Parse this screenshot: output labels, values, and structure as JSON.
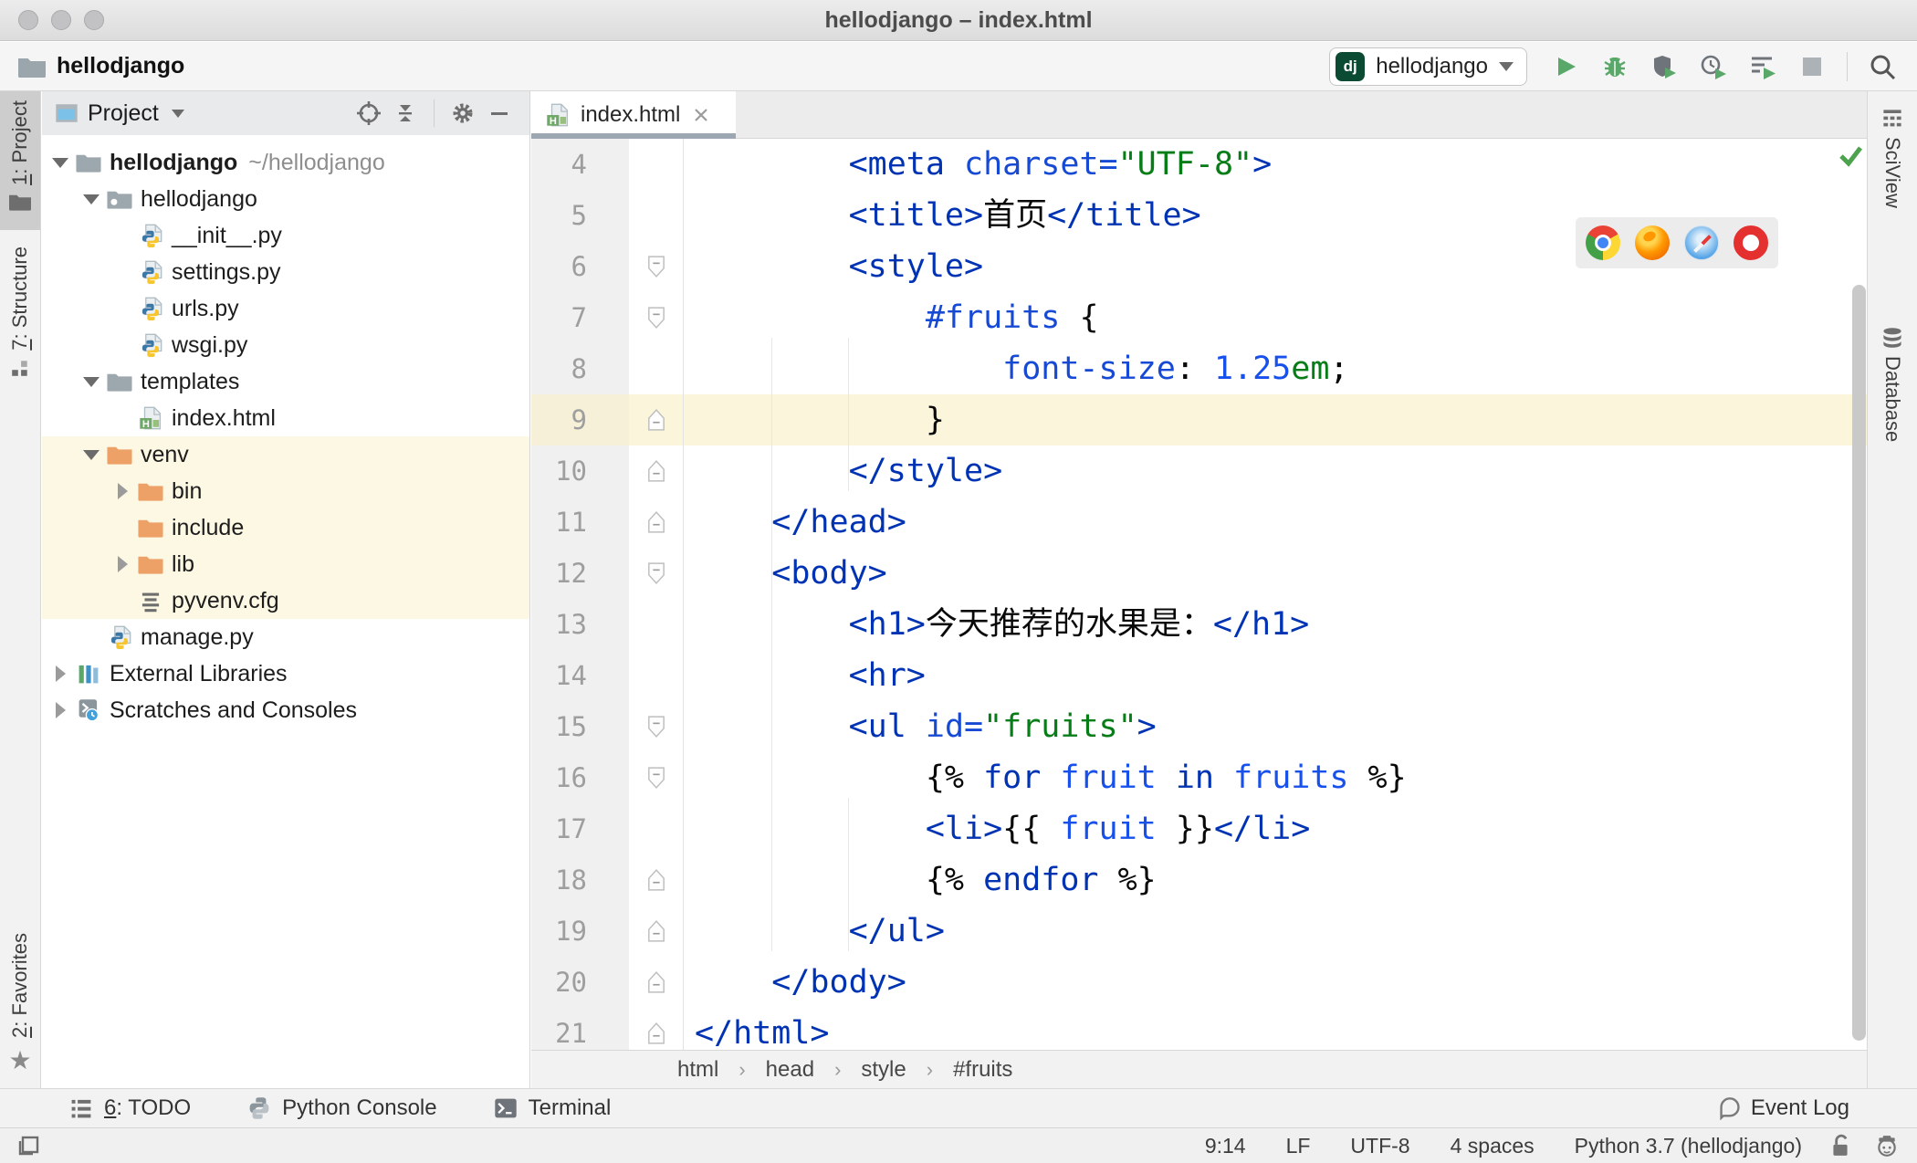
{
  "window": {
    "title": "hellodjango – index.html"
  },
  "toolbar": {
    "project_name": "hellodjango",
    "run_config": {
      "badge": "dj",
      "name": "hellodjango"
    },
    "buttons": [
      "run",
      "debug",
      "run-with-coverage",
      "profile",
      "run-with-profiler",
      "stop",
      "search-everywhere"
    ]
  },
  "left_stripe": {
    "items": [
      {
        "mnemonic": "1",
        "label": ": Project",
        "icon": "project-tool-icon",
        "selected": true
      },
      {
        "mnemonic": "7",
        "label": ": Structure",
        "icon": "structure-tool-icon",
        "selected": false
      }
    ],
    "bottom_items": [
      {
        "mnemonic": "2",
        "label": ": Favorites",
        "icon": "star-icon",
        "selected": false
      }
    ]
  },
  "right_stripe": {
    "items": [
      {
        "label": "SciView",
        "icon": "sciview-icon"
      },
      {
        "label": "Database",
        "icon": "database-icon"
      }
    ]
  },
  "project_panel": {
    "title": "Project",
    "header_icons": [
      "locate-icon",
      "collapse-all-icon",
      "settings-gear-icon",
      "hide-icon"
    ],
    "tree": [
      {
        "label": "hellodjango",
        "path": "~/hellodjango",
        "level": 0,
        "arrow": "down",
        "icon": "folder",
        "bold": true,
        "hl": false
      },
      {
        "label": "hellodjango",
        "level": 1,
        "arrow": "down",
        "icon": "folder-pkg",
        "hl": false
      },
      {
        "label": "__init__.py",
        "level": 2,
        "arrow": null,
        "icon": "python",
        "hl": false
      },
      {
        "label": "settings.py",
        "level": 2,
        "arrow": null,
        "icon": "python",
        "hl": false
      },
      {
        "label": "urls.py",
        "level": 2,
        "arrow": null,
        "icon": "python",
        "hl": false
      },
      {
        "label": "wsgi.py",
        "level": 2,
        "arrow": null,
        "icon": "python",
        "hl": false
      },
      {
        "label": "templates",
        "level": 1,
        "arrow": "down",
        "icon": "folder",
        "hl": false
      },
      {
        "label": "index.html",
        "level": 2,
        "arrow": null,
        "icon": "html",
        "hl": false
      },
      {
        "label": "venv",
        "level": 1,
        "arrow": "down",
        "icon": "folder-ex",
        "hl": true
      },
      {
        "label": "bin",
        "level": 2,
        "arrow": "right",
        "icon": "folder-ex",
        "hl": true
      },
      {
        "label": "include",
        "level": 2,
        "arrow": null,
        "icon": "folder-ex",
        "hl": true
      },
      {
        "label": "lib",
        "level": 2,
        "arrow": "right",
        "icon": "folder-ex",
        "hl": true
      },
      {
        "label": "pyvenv.cfg",
        "level": 2,
        "arrow": null,
        "icon": "cfg",
        "hl": true
      },
      {
        "label": "manage.py",
        "level": 1,
        "arrow": null,
        "icon": "python",
        "hl": false
      },
      {
        "label": "External Libraries",
        "level": 0,
        "arrow": "right",
        "icon": "lib",
        "hl": false
      },
      {
        "label": "Scratches and Consoles",
        "level": 0,
        "arrow": "right",
        "icon": "scratch",
        "hl": false
      }
    ]
  },
  "editor": {
    "tab": {
      "title": "index.html"
    },
    "inspection": "no problems",
    "browser_popup": [
      "chrome",
      "firefox",
      "safari",
      "opera"
    ],
    "breadcrumbs": [
      "html",
      "head",
      "style",
      "#fruits"
    ],
    "caret_line": 9,
    "lines": [
      {
        "n": 4,
        "fold": null,
        "tokens": [
          [
            "tag",
            "        <meta "
          ],
          [
            "attr",
            "charset="
          ],
          [
            "str",
            "\"UTF-8\""
          ],
          [
            "tag",
            ">"
          ]
        ]
      },
      {
        "n": 5,
        "fold": null,
        "tokens": [
          [
            "tag",
            "        <title>"
          ],
          [
            "pln",
            "首页"
          ],
          [
            "tag",
            "</title>"
          ]
        ]
      },
      {
        "n": 6,
        "fold": "start",
        "tokens": [
          [
            "tag",
            "        <style>"
          ]
        ]
      },
      {
        "n": 7,
        "fold": "start",
        "tokens": [
          [
            "attr",
            "            #fruits "
          ],
          [
            "pln",
            "{"
          ]
        ]
      },
      {
        "n": 8,
        "fold": null,
        "tokens": [
          [
            "attr",
            "                font-size"
          ],
          [
            "pln",
            ": "
          ],
          [
            "num",
            "1.25"
          ],
          [
            "str",
            "em"
          ],
          [
            "pln",
            ";"
          ]
        ]
      },
      {
        "n": 9,
        "fold": "end",
        "tokens": [
          [
            "pln",
            "            }"
          ]
        ]
      },
      {
        "n": 10,
        "fold": "end",
        "tokens": [
          [
            "tag",
            "        </style>"
          ]
        ]
      },
      {
        "n": 11,
        "fold": "end",
        "tokens": [
          [
            "tag",
            "    </head>"
          ]
        ]
      },
      {
        "n": 12,
        "fold": "start",
        "tokens": [
          [
            "tag",
            "    <body>"
          ]
        ]
      },
      {
        "n": 13,
        "fold": null,
        "tokens": [
          [
            "tag",
            "        <h1>"
          ],
          [
            "pln",
            "今天推荐的水果是："
          ],
          [
            "tag",
            "</h1>"
          ]
        ]
      },
      {
        "n": 14,
        "fold": null,
        "tokens": [
          [
            "tag",
            "        <hr>"
          ]
        ]
      },
      {
        "n": 15,
        "fold": "start",
        "tokens": [
          [
            "tag",
            "        <ul "
          ],
          [
            "attr",
            "id="
          ],
          [
            "str",
            "\"fruits\""
          ],
          [
            "tag",
            ">"
          ]
        ]
      },
      {
        "n": 16,
        "fold": "start",
        "tokens": [
          [
            "pln",
            "            {% "
          ],
          [
            "kw",
            "for"
          ],
          [
            "pln",
            " "
          ],
          [
            "var",
            "fruit"
          ],
          [
            "pln",
            " "
          ],
          [
            "kw",
            "in"
          ],
          [
            "pln",
            " "
          ],
          [
            "var",
            "fruits"
          ],
          [
            "pln",
            " %}"
          ]
        ]
      },
      {
        "n": 17,
        "fold": null,
        "tokens": [
          [
            "tag",
            "            <li>"
          ],
          [
            "pln",
            "{{ "
          ],
          [
            "var",
            "fruit"
          ],
          [
            "pln",
            " }}"
          ],
          [
            "tag",
            "</li>"
          ]
        ]
      },
      {
        "n": 18,
        "fold": "end",
        "tokens": [
          [
            "pln",
            "            {% "
          ],
          [
            "kw",
            "endfor"
          ],
          [
            "pln",
            " %}"
          ]
        ]
      },
      {
        "n": 19,
        "fold": "end",
        "tokens": [
          [
            "tag",
            "        </ul>"
          ]
        ]
      },
      {
        "n": 20,
        "fold": "end",
        "tokens": [
          [
            "tag",
            "    </body>"
          ]
        ]
      },
      {
        "n": 21,
        "fold": "end",
        "tokens": [
          [
            "tag",
            "</html>"
          ]
        ]
      }
    ]
  },
  "bottom_bar": {
    "todo": {
      "mnemonic": "6",
      "label": ": TODO"
    },
    "python_console": "Python Console",
    "terminal": "Terminal",
    "event_log": "Event Log"
  },
  "status_bar": {
    "position": "9:14",
    "line_ending": "LF",
    "encoding": "UTF-8",
    "indent": "4 spaces",
    "interpreter": "Python 3.7 (hellodjango)",
    "icons": [
      "lock-open-icon",
      "highlighting-level-icon"
    ]
  },
  "colors": {
    "run_green": "#59A869",
    "django_badge": "#0C4B33",
    "tag_blue": "#0033B3",
    "attr_blue": "#174AD4",
    "string_green": "#067D17",
    "number_blue": "#1750EB",
    "caret_line_bg": "#FBF5DC",
    "venv_highlight": "#FCF8E3",
    "tab_underline": "#9DA7B2",
    "excluded_folder": "#EDA167"
  }
}
